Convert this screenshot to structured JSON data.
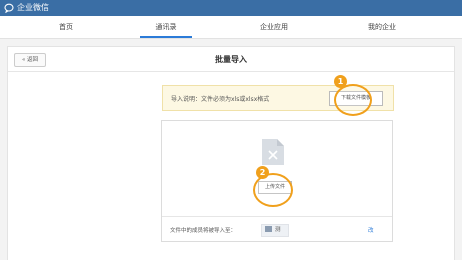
{
  "app": {
    "title": "企业微信"
  },
  "nav": {
    "tabs": [
      {
        "label": "首页"
      },
      {
        "label": "通讯录"
      },
      {
        "label": "企业应用"
      },
      {
        "label": "我的企业"
      }
    ]
  },
  "header": {
    "back_label": "« 返回",
    "title": "批量导入"
  },
  "notice": {
    "text": "导入说明：文件必须为xls或xlsx格式",
    "download_label": "下载文件模板"
  },
  "badges": {
    "one": "1",
    "two": "2"
  },
  "upload": {
    "button_label": "上传文件"
  },
  "footer": {
    "text": "文件中的成员将被导入至：",
    "department": "测",
    "modify_label": "改"
  },
  "colors": {
    "titlebar": "#3a6ea5",
    "accent": "#2b7bd8",
    "badge": "#f0a01c"
  }
}
